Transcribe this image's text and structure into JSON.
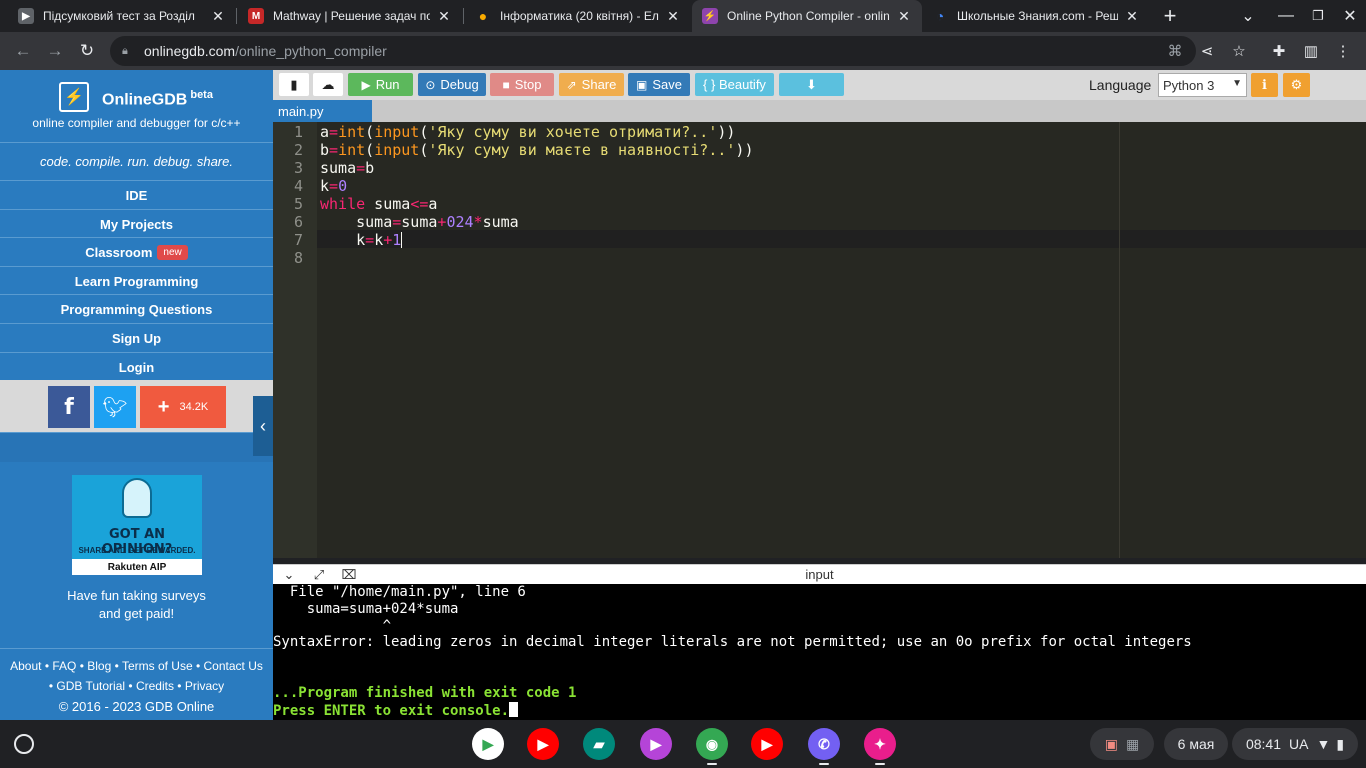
{
  "browser": {
    "tabs": [
      {
        "title": "Підсумковий тест за Розділ",
        "icon": "doc-icon",
        "color": "#5f6368"
      },
      {
        "title": "Mathway | Решение задач по",
        "icon": "mathway-icon",
        "color": "#c62828"
      },
      {
        "title": "Інформатика (20 квітня) - Ел",
        "icon": "bulb-icon",
        "color": "#f9ab00"
      },
      {
        "title": "Online Python Compiler - onlin",
        "icon": "onlinegdb-icon",
        "color": "#8e44ad"
      },
      {
        "title": "Школьные Знания.com - Реш",
        "icon": "znanija-icon",
        "color": "#4285f4"
      }
    ],
    "new_tab": "+",
    "url_domain": "onlinegdb.com",
    "url_path": "/online_python_compiler"
  },
  "sidebar": {
    "brand": "OnlineGDB",
    "brand_sup": "beta",
    "tagline": "online compiler and debugger for c/c++",
    "slogan": "code. compile. run. debug. share.",
    "menu": [
      "IDE",
      "My Projects",
      "Classroom",
      "Learn Programming",
      "Programming Questions",
      "Sign Up",
      "Login"
    ],
    "new_badge": "new",
    "share_count": "34.2K",
    "ad": {
      "headline": "GOT AN OPINION?",
      "sub": "SHARE AND GET REWARDED.",
      "brand": "Rakuten AIP",
      "text_line1": "Have fun taking surveys",
      "text_line2": "and get paid!"
    },
    "footer": {
      "links_row1": [
        "About",
        "FAQ",
        "Blog",
        "Terms of Use",
        "Contact Us"
      ],
      "links_row2": [
        "GDB Tutorial",
        "Credits",
        "Privacy"
      ],
      "copyright": "© 2016 - 2023 GDB Online"
    }
  },
  "ide": {
    "buttons": {
      "run": "Run",
      "debug": "Debug",
      "stop": "Stop",
      "share": "Share",
      "save": "Save",
      "beautify": "{ } Beautify"
    },
    "language_label": "Language",
    "language_value": "Python 3",
    "file_tab": "main.py",
    "console_title": "input",
    "colors": {
      "run": "#5cb85c",
      "debug": "#337ab7",
      "stop": "#d9534f",
      "share": "#f0ad4e",
      "save": "#337ab7",
      "beautify": "#5bc0de",
      "download": "#5bc0de"
    }
  },
  "code_lines": [
    "a=int(input('Яку суму ви хочете отримати?..'))",
    "b=int(input('Яку суму ви маєте в наявності?..'))",
    "suma=b",
    "k=0",
    "while suma<=a",
    "    suma=suma+024*suma",
    "    k=k+1",
    ""
  ],
  "console_lines": [
    "  File \"/home/main.py\", line 6",
    "    suma=suma+024*suma",
    "             ^",
    "SyntaxError: leading zeros in decimal integer literals are not permitted; use an 0o prefix for octal integers",
    "",
    "",
    "...Program finished with exit code 1",
    "Press ENTER to exit console."
  ],
  "shelf": {
    "date": "6 мая",
    "time": "08:41",
    "locale": "UA",
    "apps": [
      {
        "name": "play-store-icon",
        "color": "#ffffff"
      },
      {
        "name": "youtube-icon",
        "color": "#ff0000"
      },
      {
        "name": "meet-icon",
        "color": "#00897b"
      },
      {
        "name": "play-movies-icon",
        "color": "#b544d8"
      },
      {
        "name": "chrome-icon",
        "color": "#34a853"
      },
      {
        "name": "youtube-music-icon",
        "color": "#ff0000"
      },
      {
        "name": "viber-icon",
        "color": "#7360f2"
      },
      {
        "name": "gallery-icon",
        "color": "#e91e8c"
      }
    ]
  }
}
